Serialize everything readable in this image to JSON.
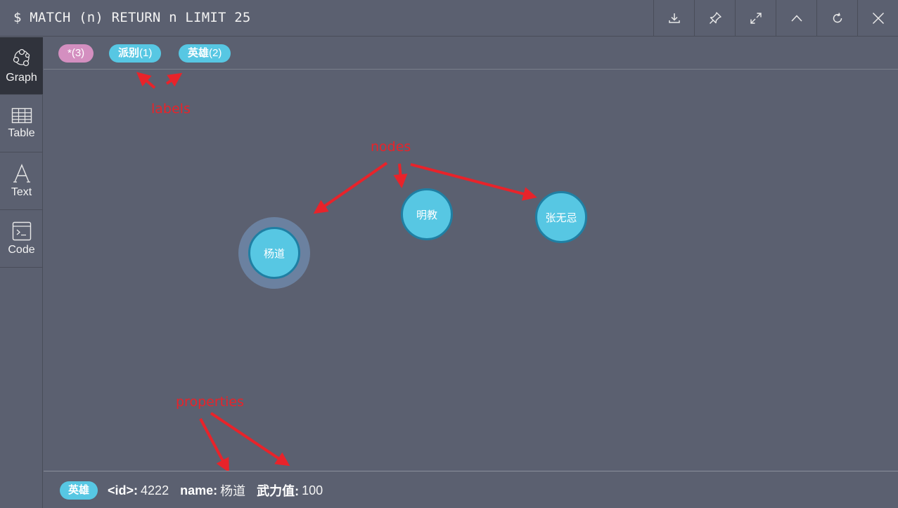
{
  "query": "$ MATCH (n) RETURN n LIMIT 25",
  "toolbar": {
    "buttons": [
      {
        "icon": "download-icon"
      },
      {
        "icon": "pin-icon"
      },
      {
        "icon": "expand-icon"
      },
      {
        "icon": "collapse-icon"
      },
      {
        "icon": "rerun-icon"
      },
      {
        "icon": "close-icon"
      }
    ]
  },
  "sidebar": {
    "items": [
      {
        "label": "Graph",
        "icon": "graph-icon",
        "active": true
      },
      {
        "label": "Table",
        "icon": "table-icon",
        "active": false
      },
      {
        "label": "Text",
        "icon": "text-icon",
        "active": false
      },
      {
        "label": "Code",
        "icon": "code-icon",
        "active": false
      }
    ]
  },
  "labels": [
    {
      "name": "*",
      "count": "(3)",
      "color": "#d48fc0"
    },
    {
      "name": "派别",
      "count": "(1)",
      "color": "#57c7e3"
    },
    {
      "name": "英雄",
      "count": "(2)",
      "color": "#57c7e3"
    }
  ],
  "nodes": [
    {
      "caption": "杨道",
      "selected": true
    },
    {
      "caption": "明教",
      "selected": false
    },
    {
      "caption": "张无忌",
      "selected": false
    }
  ],
  "annotations": {
    "labels": "labels",
    "nodes": "nodes",
    "properties": "properties"
  },
  "properties": {
    "label": "英雄",
    "items": [
      {
        "key": "<id>:",
        "value": "4222"
      },
      {
        "key": "name:",
        "value": "杨道"
      },
      {
        "key": "武力值:",
        "value": "100"
      }
    ]
  },
  "colors": {
    "background": "#5b6070",
    "node_fill": "#57c7e3",
    "node_border": "#1f7fa3",
    "annotation": "#e8232a",
    "all_label": "#d48fc0"
  }
}
